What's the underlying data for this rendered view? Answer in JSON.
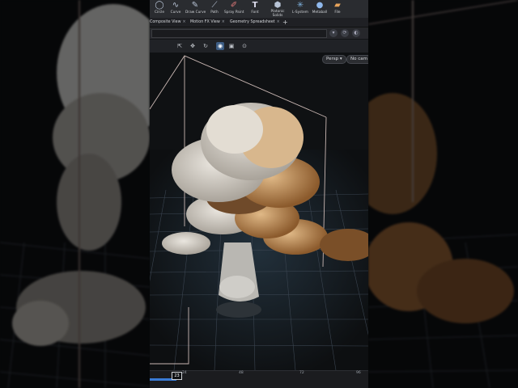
{
  "shelf": {
    "tools": [
      {
        "label": "Circle",
        "icon": "circle-icon"
      },
      {
        "label": "Curve",
        "icon": "curve-icon"
      },
      {
        "label": "Draw Curve",
        "icon": "draw-curve-icon"
      },
      {
        "label": "Path",
        "icon": "path-icon"
      },
      {
        "label": "Spray Paint",
        "icon": "spray-paint-icon"
      },
      {
        "label": "Font",
        "icon": "font-icon"
      },
      {
        "label": "Platonic Solids",
        "icon": "platonic-solids-icon"
      },
      {
        "label": "L-System",
        "icon": "l-system-icon"
      },
      {
        "label": "Metaball",
        "icon": "metaball-icon"
      },
      {
        "label": "File",
        "icon": "file-icon"
      }
    ]
  },
  "tabs": [
    "Composite View",
    "Motion FX View",
    "Geometry Spreadsheet"
  ],
  "viewport": {
    "persp_label": "Persp",
    "cam_label": "No cam"
  },
  "timeline": {
    "current_frame": "23",
    "ticks": [
      "24",
      "48",
      "72",
      "96"
    ]
  }
}
